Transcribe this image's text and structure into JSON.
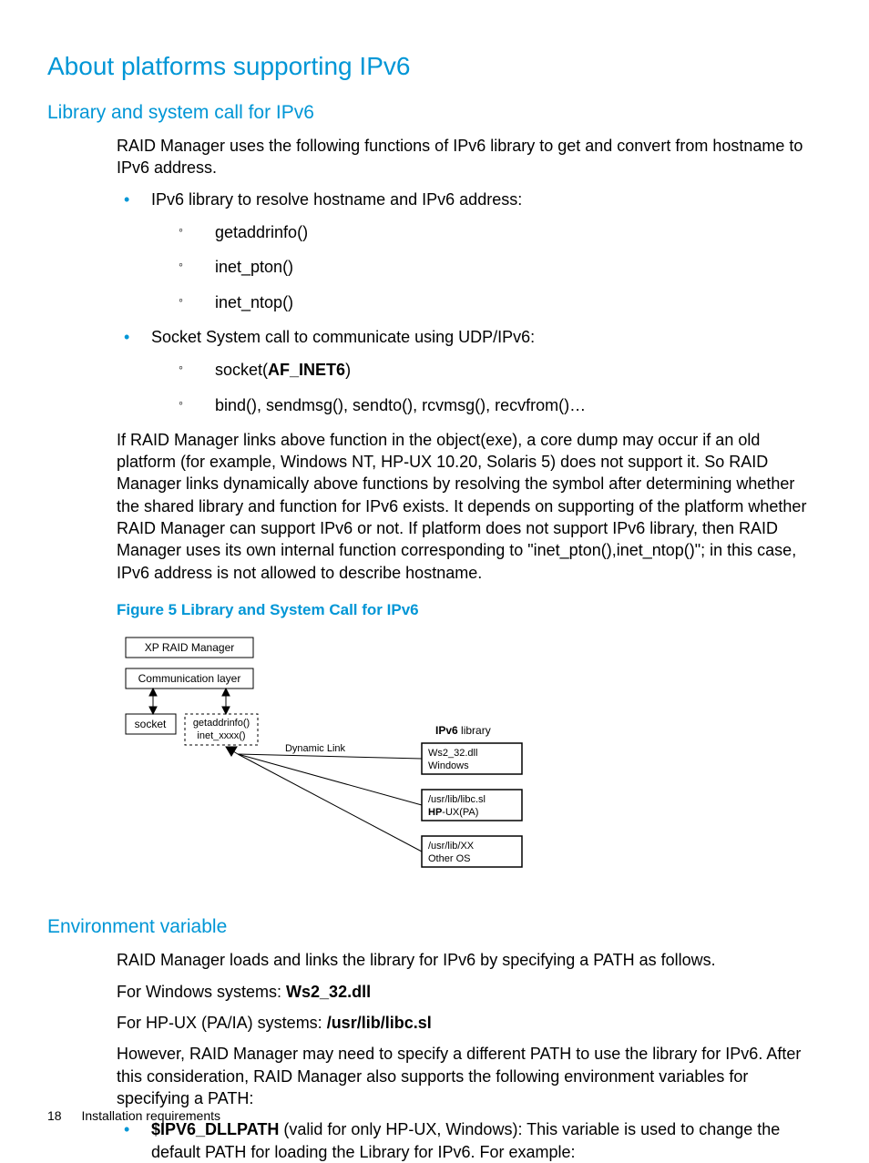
{
  "headings": {
    "main": "About platforms supporting IPv6",
    "sub1": "Library and system call for IPv6",
    "sub2": "Environment variable"
  },
  "intro": "RAID Manager uses the following functions of IPv6 library to get and convert from hostname to IPv6 address.",
  "list1": {
    "item1": "IPv6 library to resolve hostname and IPv6 address:",
    "sub": {
      "a": "getaddrinfo()",
      "b": "inet_pton()",
      "c": "inet_ntop()"
    },
    "item2": "Socket System call to communicate using UDP/IPv6:",
    "sub2": {
      "a_pre": "socket(",
      "a_bold": "AF_INET6",
      "a_post": ")",
      "b": "bind(), sendmsg(), sendto(), rcvmsg(), recvfrom()…"
    }
  },
  "para2": "If RAID Manager links above function in the object(exe), a core dump may occur if an old platform (for example, Windows NT, HP-UX 10.20, Solaris 5) does not support it. So RAID Manager links dynamically above functions by resolving the symbol after determining whether the shared library and function for IPv6 exists. It depends on supporting of the platform whether RAID Manager can support IPv6 or not. If platform does not support IPv6 library, then RAID Manager uses its own internal function corresponding to \"inet_pton(),inet_ntop()\"; in this case, IPv6 address is not allowed to describe hostname.",
  "figure": {
    "caption": "Figure 5 Library and System Call for IPv6",
    "box_top": "XP RAID Manager",
    "box_comm": "Communication layer",
    "box_socket": "socket",
    "box_getaddr_l1": "getaddrinfo()",
    "box_getaddr_l2": "inet_xxxx()",
    "label_dynlink": "Dynamic Link",
    "label_ipv6_pre": "IPv6",
    "label_ipv6_post": " library",
    "lib1_l1": "Ws2_32.dll",
    "lib1_l2": "Windows",
    "lib2_l1": "/usr/lib/libc.sl",
    "lib2_l2_pre": "HP",
    "lib2_l2_post": "-UX(PA)",
    "lib3_l1": "/usr/lib/XX",
    "lib3_l2": "Other OS"
  },
  "env": {
    "p1": "RAID Manager loads and links the library for IPv6 by specifying a PATH as follows.",
    "p2_pre": "For Windows systems: ",
    "p2_bold": "Ws2_32.dll",
    "p3_pre": "For HP-UX (PA/IA) systems: ",
    "p3_bold": "/usr/lib/libc.sl",
    "p4": "However, RAID Manager may need to specify a different PATH to use the library for IPv6. After this consideration, RAID Manager also supports the following environment variables for specifying a PATH:",
    "bullet_bold": "$IPV6_DLLPATH",
    "bullet_rest": " (valid for only HP-UX, Windows): This variable is used to change the default PATH for loading the Library for IPv6. For example:"
  },
  "footer": {
    "page": "18",
    "section": "Installation requirements"
  }
}
